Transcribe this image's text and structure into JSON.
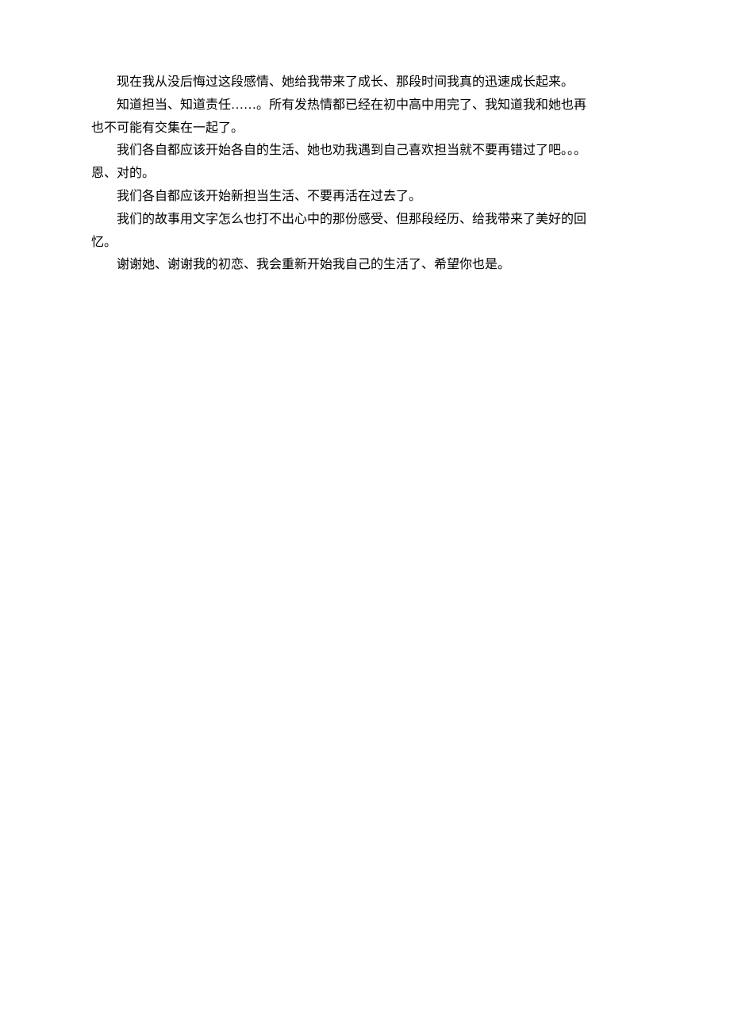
{
  "paragraphs": [
    {
      "text": "现在我从没后悔过这段感情、她给我带来了成长、那段时间我真的迅速成长起来。",
      "indent": true
    },
    {
      "text": "知道担当、知道责任……。所有发热情都已经在初中高中用完了、我知道我和她也再",
      "indent": true
    },
    {
      "text": "也不可能有交集在一起了。",
      "indent": false
    },
    {
      "text": "我们各自都应该开始各自的生活、她也劝我遇到自己喜欢担当就不要再错过了吧。。。",
      "indent": true
    },
    {
      "text": "恩、对的。",
      "indent": false
    },
    {
      "text": "我们各自都应该开始新担当生活、不要再活在过去了。",
      "indent": true
    },
    {
      "text": "我们的故事用文字怎么也打不出心中的那份感受、但那段经历、给我带来了美好的回",
      "indent": true
    },
    {
      "text": "忆。",
      "indent": false
    },
    {
      "text": "谢谢她、谢谢我的初恋、我会重新开始我自己的生活了、希望你也是。",
      "indent": true
    }
  ]
}
